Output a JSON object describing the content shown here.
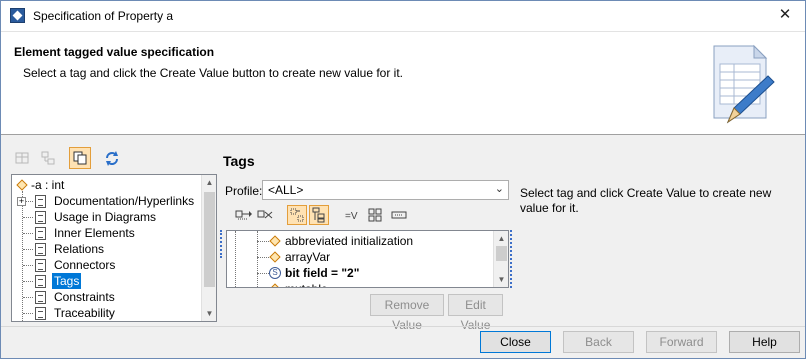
{
  "window": {
    "title": "Specification of Property a"
  },
  "header": {
    "title": "Element tagged value specification",
    "description": "Select a tag and click the Create Value button to create new value for it."
  },
  "left_toolbar": {
    "icons": [
      "table-view-icon",
      "tree-view-icon",
      "copy-icon",
      "refresh-icon"
    ]
  },
  "tree": {
    "items": [
      {
        "label": "-a : int",
        "icon": "property-icon"
      },
      {
        "label": "Documentation/Hyperlinks",
        "icon": "doc-icon",
        "expandable": true
      },
      {
        "label": "Usage in Diagrams",
        "icon": "doc-icon"
      },
      {
        "label": "Inner Elements",
        "icon": "doc-icon"
      },
      {
        "label": "Relations",
        "icon": "doc-icon"
      },
      {
        "label": "Connectors",
        "icon": "doc-icon"
      },
      {
        "label": "Tags",
        "icon": "doc-icon",
        "selected": true
      },
      {
        "label": "Constraints",
        "icon": "doc-icon"
      },
      {
        "label": "Traceability",
        "icon": "doc-icon"
      }
    ]
  },
  "tags_panel": {
    "title": "Tags",
    "profile_label": "Profile:",
    "profile_value": "<ALL>",
    "help_text": "Select tag and click Create Value to create new value for it.",
    "tag_items": [
      {
        "label": "abbreviated initialization",
        "bold": false
      },
      {
        "label": "arrayVar",
        "bold": false
      },
      {
        "label": "bit field = \"2\"",
        "bold": true
      },
      {
        "label": "mutable",
        "bold": false
      }
    ],
    "remove_value_label": "Remove Value",
    "edit_value_label": "Edit Value"
  },
  "footer": {
    "close_label": "Close",
    "back_label": "Back",
    "forward_label": "Forward",
    "help_label": "Help"
  },
  "colors": {
    "selection": "#0078d7",
    "active_toggle_bg": "#ffe2b3",
    "active_toggle_border": "#e39e3b"
  }
}
